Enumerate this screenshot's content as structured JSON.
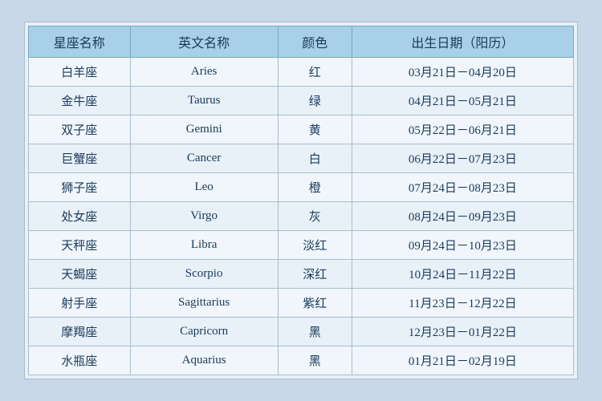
{
  "table": {
    "headers": {
      "cn_name": "星座名称",
      "en_name": "英文名称",
      "color": "颜色",
      "birth_date": "出生日期（阳历）"
    },
    "rows": [
      {
        "cn": "白羊座",
        "en": "Aries",
        "color": "红",
        "date": "03月21日－04月20日"
      },
      {
        "cn": "金牛座",
        "en": "Taurus",
        "color": "绿",
        "date": "04月21日－05月21日"
      },
      {
        "cn": "双子座",
        "en": "Gemini",
        "color": "黄",
        "date": "05月22日－06月21日"
      },
      {
        "cn": "巨蟹座",
        "en": "Cancer",
        "color": "白",
        "date": "06月22日－07月23日"
      },
      {
        "cn": "狮子座",
        "en": "Leo",
        "color": "橙",
        "date": "07月24日－08月23日"
      },
      {
        "cn": "处女座",
        "en": "Virgo",
        "color": "灰",
        "date": "08月24日－09月23日"
      },
      {
        "cn": "天秤座",
        "en": "Libra",
        "color": "淡红",
        "date": "09月24日－10月23日"
      },
      {
        "cn": "天蝎座",
        "en": "Scorpio",
        "color": "深红",
        "date": "10月24日－11月22日"
      },
      {
        "cn": "射手座",
        "en": "Sagittarius",
        "color": "紫红",
        "date": "11月23日－12月22日"
      },
      {
        "cn": "摩羯座",
        "en": "Capricorn",
        "color": "黑",
        "date": "12月23日－01月22日"
      },
      {
        "cn": "水瓶座",
        "en": "Aquarius",
        "color": "黑",
        "date": "01月21日－02月19日"
      }
    ]
  }
}
